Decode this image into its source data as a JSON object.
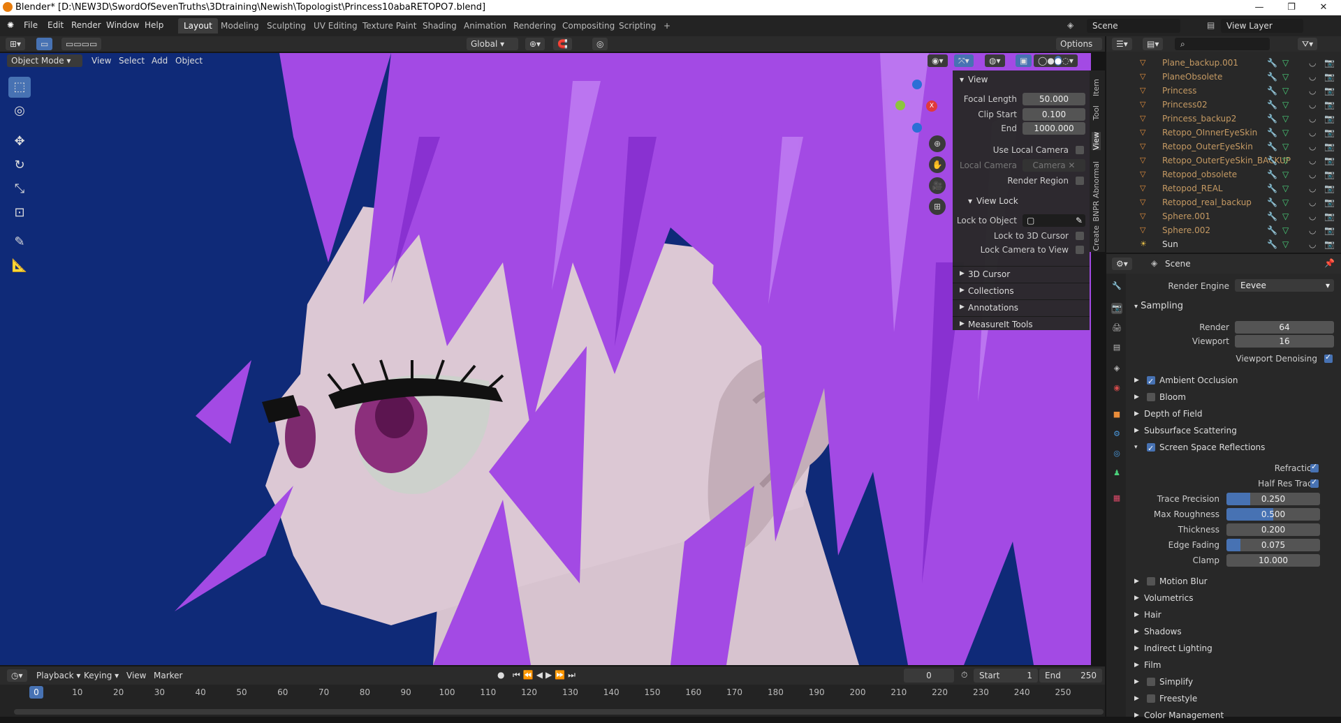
{
  "window": {
    "title": "Blender* [D:\\NEW3D\\SwordOfSevenTruths\\3Dtraining\\Newish\\Topologist\\Princess10abaRETOPO7.blend]"
  },
  "menu": [
    "File",
    "Edit",
    "Render",
    "Window",
    "Help"
  ],
  "workspaces": [
    "Layout",
    "Modeling",
    "Sculpting",
    "UV Editing",
    "Texture Paint",
    "Shading",
    "Animation",
    "Rendering",
    "Compositing",
    "Scripting"
  ],
  "active_workspace": "Layout",
  "scene_field": "Scene",
  "view_layer_field": "View Layer",
  "viewport": {
    "mode": "Object Mode",
    "menus": [
      "View",
      "Select",
      "Add",
      "Object"
    ],
    "transform_orientation": "Global",
    "options_label": "Options",
    "bg_color": "#0f2a78",
    "hair_color": "#a54ae6",
    "skin_color": "#d9c6d2"
  },
  "npanel": {
    "view_header": "View",
    "focal_length_label": "Focal Length",
    "focal_length": "50.000",
    "clip_start_label": "Clip Start",
    "clip_start": "0.100",
    "end_label": "End",
    "end": "1000.000",
    "use_local_camera": "Use Local Camera",
    "local_camera_label": "Local Camera",
    "local_camera_value": "Camera",
    "render_region": "Render Region",
    "view_lock_header": "View Lock",
    "lock_to_object": "Lock to Object",
    "lock_to_3d_cursor": "Lock to 3D Cursor",
    "lock_camera_to_view": "Lock Camera to View",
    "sections": [
      "3D Cursor",
      "Collections",
      "Annotations",
      "MeasureIt Tools"
    ],
    "tabs": [
      "Item",
      "Tool",
      "View",
      "BNPR Abnormal",
      "Create"
    ]
  },
  "outliner": {
    "items": [
      {
        "name": "Plane_backup.001"
      },
      {
        "name": "PlaneObsolete"
      },
      {
        "name": "Princess"
      },
      {
        "name": "Princess02"
      },
      {
        "name": "Princess_backup2"
      },
      {
        "name": "Retopo_OInnerEyeSkin"
      },
      {
        "name": "Retopo_OuterEyeSkin"
      },
      {
        "name": "Retopo_OuterEyeSkin_BACKUP"
      },
      {
        "name": "Retopod_obsolete"
      },
      {
        "name": "Retopod_REAL"
      },
      {
        "name": "Retopod_real_backup"
      },
      {
        "name": "Sphere.001"
      },
      {
        "name": "Sphere.002"
      },
      {
        "name": "Sun"
      }
    ]
  },
  "properties": {
    "scene_label": "Scene",
    "render_engine_label": "Render Engine",
    "render_engine": "Eevee",
    "sampling": "Sampling",
    "render_label": "Render",
    "render_value": "64",
    "viewport_label": "Viewport",
    "viewport_value": "16",
    "viewport_denoising": "Viewport Denoising",
    "sections_a": [
      "Ambient Occlusion",
      "Bloom",
      "Depth of Field",
      "Subsurface Scattering",
      "Screen Space Reflections"
    ],
    "refraction": "Refraction",
    "half_res_trace": "Half Res Trace",
    "trace_precision_label": "Trace Precision",
    "trace_precision": "0.250",
    "max_roughness_label": "Max Roughness",
    "max_roughness": "0.500",
    "thickness_label": "Thickness",
    "thickness": "0.200",
    "edge_fading_label": "Edge Fading",
    "edge_fading": "0.075",
    "clamp_label": "Clamp",
    "clamp": "10.000",
    "sections_b": [
      "Motion Blur",
      "Volumetrics",
      "Hair",
      "Shadows",
      "Indirect Lighting",
      "Film",
      "Simplify",
      "Freestyle",
      "Color Management"
    ]
  },
  "timeline": {
    "menus": [
      "Playback",
      "Keying",
      "View",
      "Marker"
    ],
    "current_frame": "0",
    "start_label": "Start",
    "start": "1",
    "end_label": "End",
    "end": "250",
    "ticks": [
      "0",
      "10",
      "20",
      "30",
      "40",
      "50",
      "60",
      "70",
      "80",
      "90",
      "100",
      "110",
      "120",
      "130",
      "140",
      "150",
      "160",
      "170",
      "180",
      "190",
      "200",
      "210",
      "220",
      "230",
      "240",
      "250"
    ]
  }
}
